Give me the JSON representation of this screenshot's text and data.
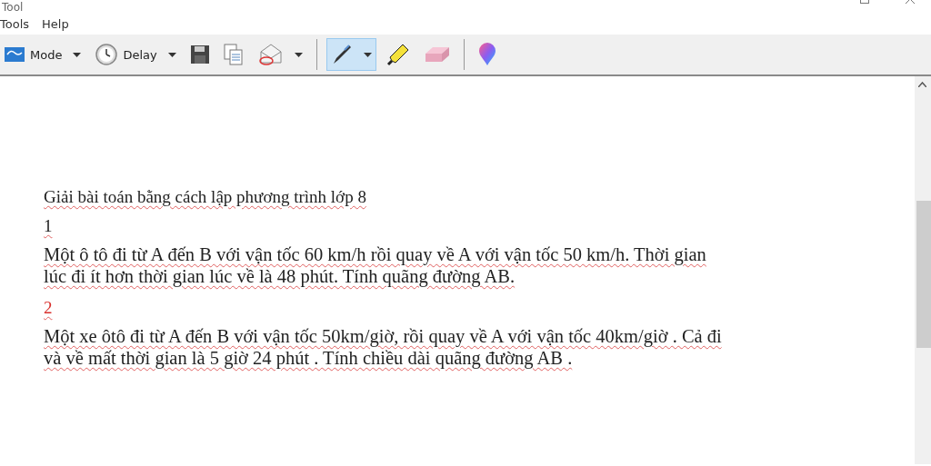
{
  "window": {
    "title": "Tool"
  },
  "menu": [
    "Tools",
    "Help"
  ],
  "toolbar": [
    {
      "kind": "mode",
      "label": "Mode"
    },
    {
      "kind": "delay",
      "label": "Delay"
    },
    {
      "kind": "save"
    },
    {
      "kind": "copy"
    },
    {
      "kind": "send"
    },
    {
      "kind": "separator"
    },
    {
      "kind": "pen",
      "selected": true
    },
    {
      "kind": "highlighter",
      "selected": false
    },
    {
      "kind": "eraser",
      "selected": false
    },
    {
      "kind": "separator"
    },
    {
      "kind": "paint",
      "selected": false
    }
  ],
  "document": [
    {
      "kind": "title",
      "lines": [
        "Giải bài toán bằng cách lập phương trình lớp 8"
      ],
      "color": "#222222"
    },
    {
      "kind": "number",
      "lines": [
        "1"
      ],
      "color": "#222222"
    },
    {
      "kind": "paragraph",
      "lines": [
        "Một ô tô đi từ A đến B với vận tốc 60 km/h rồi quay về A với vận tốc 50 km/h. Thời gian",
        "lúc đi ít hơn thời gian lúc về là 48 phút. Tính quãng đường AB."
      ],
      "color": "#222222"
    },
    {
      "kind": "number",
      "lines": [
        "2"
      ],
      "color": "#d9302c"
    },
    {
      "kind": "paragraph",
      "lines": [
        "Một xe ôtô đi từ A đến B với vận tốc 50km/giờ, rồi quay về A với vận tốc 40km/giờ . Cả đi",
        "và về mất thời gian là 5 giờ 24 phút . Tính chiều dài quãng đường AB ."
      ],
      "color": "#222222"
    }
  ]
}
